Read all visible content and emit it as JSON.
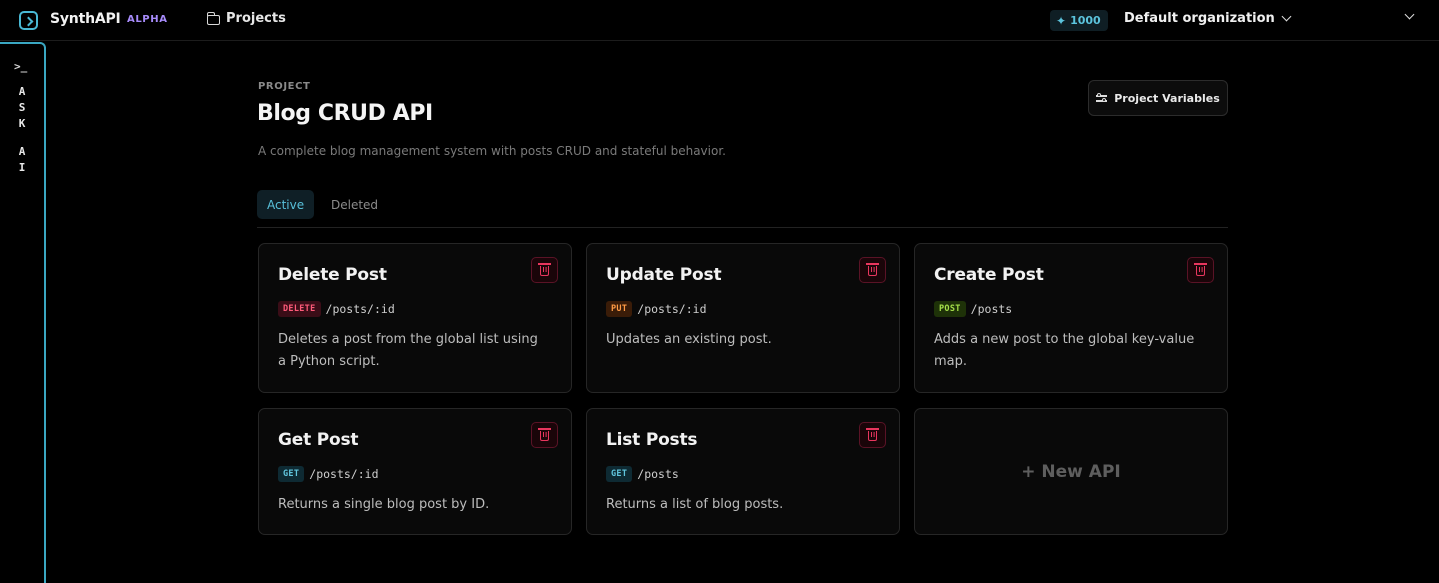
{
  "topbar": {
    "brand": "SynthAPI",
    "badge": "ALPHA",
    "projects_label": "Projects",
    "credits": "1000",
    "organization": "Default organization"
  },
  "rail": {
    "prompt": ">_",
    "letters_1": [
      "A",
      "S",
      "K"
    ],
    "letters_2": [
      "A",
      "I"
    ]
  },
  "project": {
    "eyebrow": "PROJECT",
    "title": "Blog CRUD API",
    "description": "A complete blog management system with posts CRUD and stateful behavior.",
    "variables_button": "Project Variables"
  },
  "tabs": [
    {
      "label": "Active",
      "active": true
    },
    {
      "label": "Deleted",
      "active": false
    }
  ],
  "apis": [
    {
      "name": "Delete Post",
      "method": "DELETE",
      "path": "/posts/:id",
      "description": "Deletes a post from the global list using a Python script."
    },
    {
      "name": "Update Post",
      "method": "PUT",
      "path": "/posts/:id",
      "description": "Updates an existing post."
    },
    {
      "name": "Create Post",
      "method": "POST",
      "path": "/posts",
      "description": "Adds a new post to the global key-value map."
    },
    {
      "name": "Get Post",
      "method": "GET",
      "path": "/posts/:id",
      "description": "Returns a single blog post by ID."
    },
    {
      "name": "List Posts",
      "method": "GET",
      "path": "/posts",
      "description": "Returns a list of blog posts."
    }
  ],
  "new_api_label": "+ New API",
  "colors": {
    "accent": "#49b8d4",
    "delete": "#ff5b7a",
    "put": "#ff9b45",
    "post": "#a6e04a",
    "get": "#61c6de"
  }
}
